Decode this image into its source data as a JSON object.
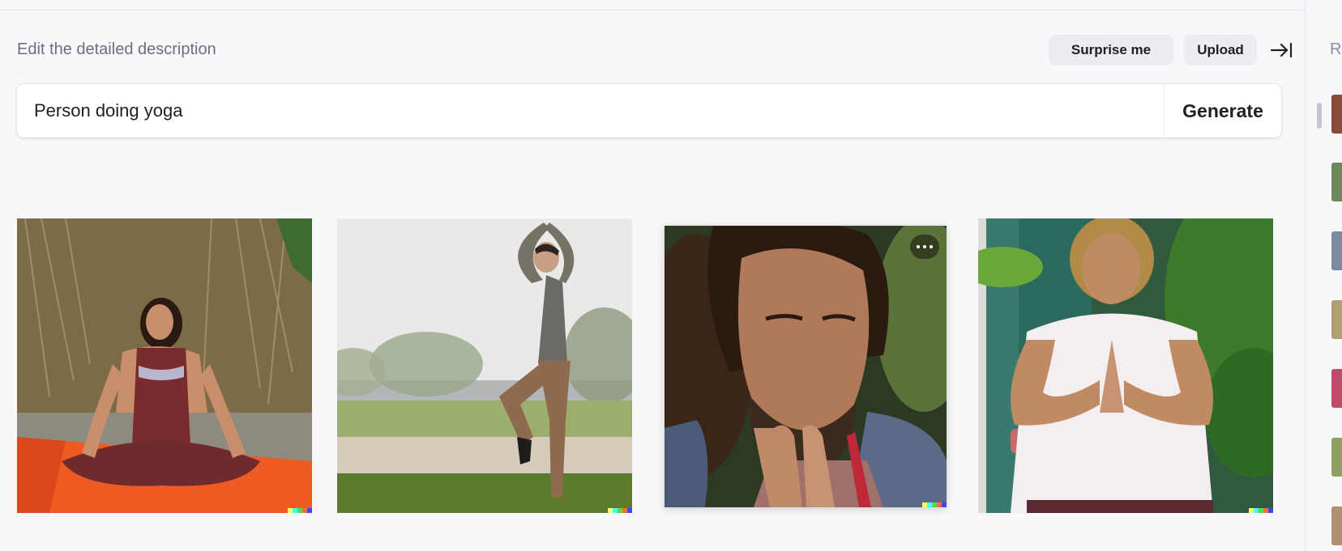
{
  "header": {
    "heading": "Edit the detailed description",
    "surprise_label": "Surprise me",
    "upload_label": "Upload",
    "collapse_icon": "arrow-right-to-bar-icon"
  },
  "prompt": {
    "value": "Person doing yoga",
    "generate_label": "Generate"
  },
  "results": [
    {
      "name": "woman-meditating-lotus-pose"
    },
    {
      "name": "man-tree-pose-field"
    },
    {
      "name": "man-praying-hands-closeup",
      "selected": true,
      "more_icon": "more-horizontal-icon"
    },
    {
      "name": "woman-namaste-pose"
    }
  ],
  "history": {
    "label": "R",
    "thumb_colors": [
      "#8a4a3a",
      "#6f8a5a",
      "#7a8aa0",
      "#b0a070",
      "#c04a6a",
      "#90a060",
      "#b09070"
    ]
  },
  "colors": {
    "background": "#f8f8fa",
    "pill": "#ececf1",
    "watermark": [
      "#ffff66",
      "#42ffff",
      "#51da4c",
      "#ff6e3c",
      "#3c46ff"
    ]
  }
}
